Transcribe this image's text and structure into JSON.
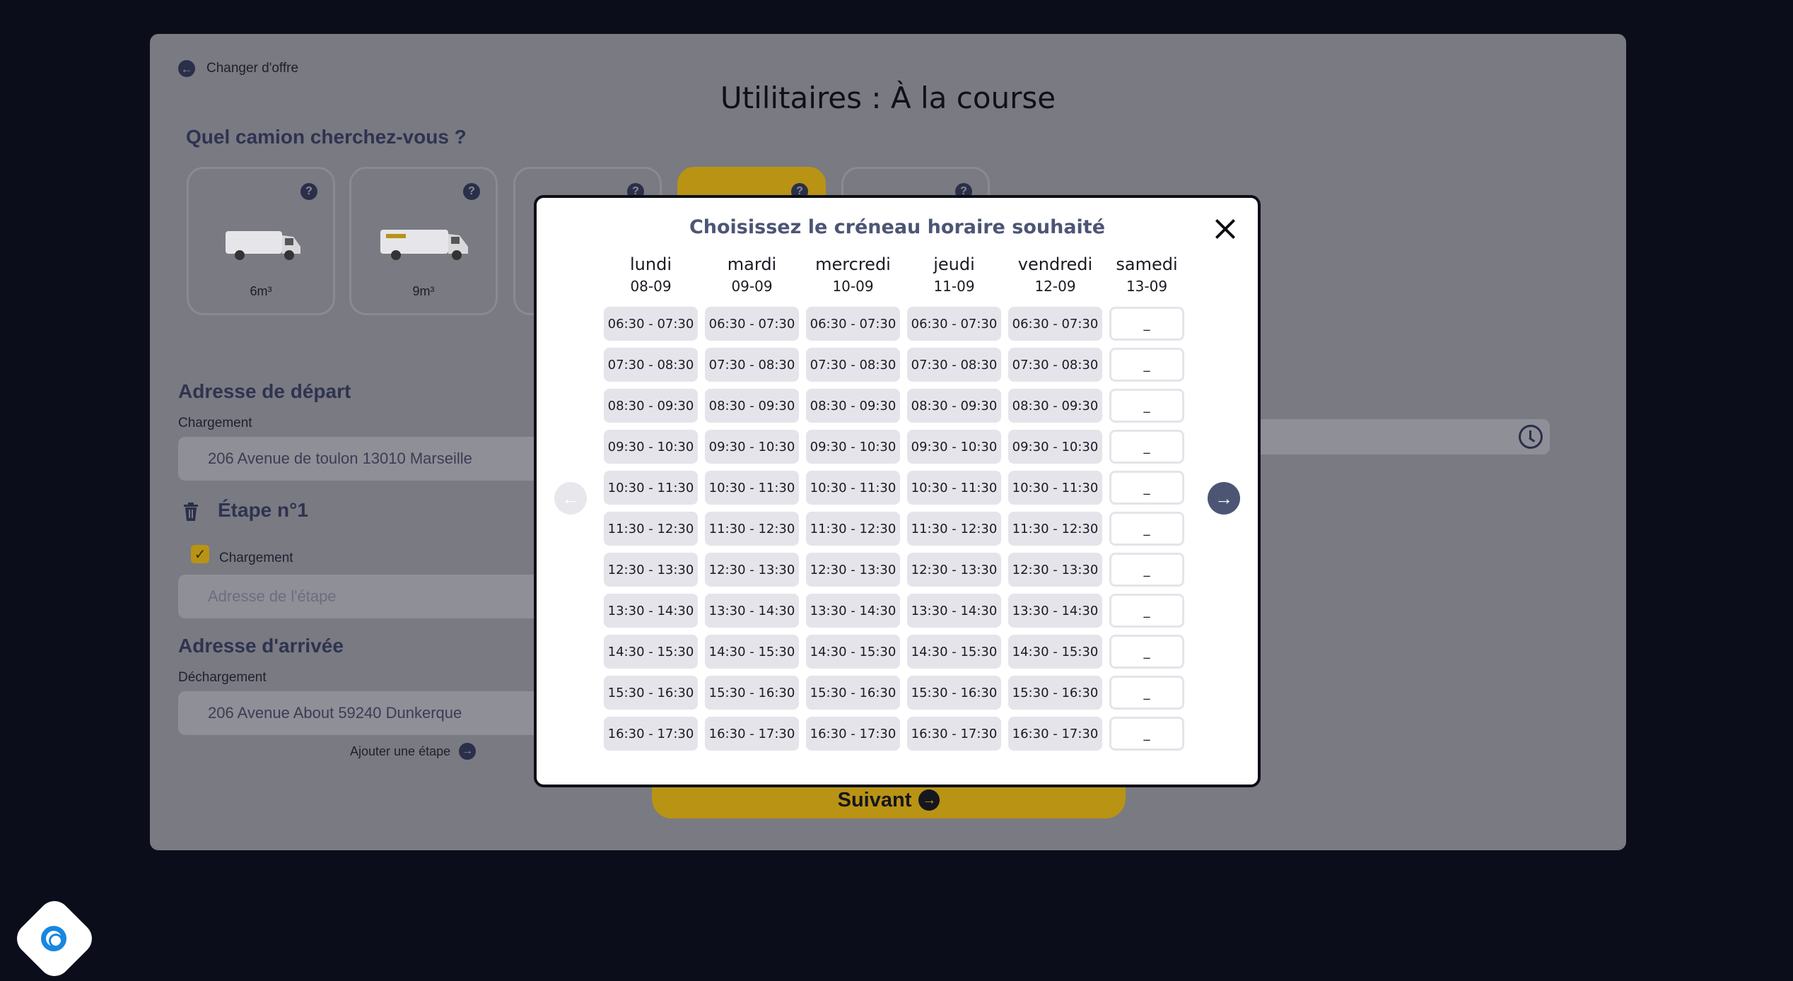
{
  "background": {
    "back_link": "Changer d'offre",
    "title": "Utilitaires : À la course",
    "truck_question": "Quel camion cherchez-vous ?",
    "trucks": [
      {
        "size": "6m³"
      },
      {
        "size": "9m³"
      },
      {
        "size": ""
      },
      {
        "size": ""
      },
      {
        "size": ""
      }
    ],
    "help_glyph": "?",
    "departure": {
      "section_title": "Adresse de départ",
      "label": "Chargement",
      "value": "206 Avenue de toulon 13010 Marseille"
    },
    "step": {
      "section_title": "Étape n°1",
      "checkbox_label": "Chargement",
      "placeholder": "Adresse de l'étape"
    },
    "arrival": {
      "section_title": "Adresse d'arrivée",
      "label": "Déchargement",
      "value": "206 Avenue About 59240 Dunkerque"
    },
    "add_step_label": "Ajouter une étape",
    "next_label": "Suivant"
  },
  "modal": {
    "title": "Choisissez le créneau horaire souhaité",
    "days": [
      {
        "name": "lundi",
        "date": "08-09",
        "slots": [
          "06:30 - 07:30",
          "07:30 - 08:30",
          "08:30 - 09:30",
          "09:30 - 10:30",
          "10:30 - 11:30",
          "11:30 - 12:30",
          "12:30 - 13:30",
          "13:30 - 14:30",
          "14:30 - 15:30",
          "15:30 - 16:30",
          "16:30 - 17:30"
        ]
      },
      {
        "name": "mardi",
        "date": "09-09",
        "slots": [
          "06:30 - 07:30",
          "07:30 - 08:30",
          "08:30 - 09:30",
          "09:30 - 10:30",
          "10:30 - 11:30",
          "11:30 - 12:30",
          "12:30 - 13:30",
          "13:30 - 14:30",
          "14:30 - 15:30",
          "15:30 - 16:30",
          "16:30 - 17:30"
        ]
      },
      {
        "name": "mercredi",
        "date": "10-09",
        "slots": [
          "06:30 - 07:30",
          "07:30 - 08:30",
          "08:30 - 09:30",
          "09:30 - 10:30",
          "10:30 - 11:30",
          "11:30 - 12:30",
          "12:30 - 13:30",
          "13:30 - 14:30",
          "14:30 - 15:30",
          "15:30 - 16:30",
          "16:30 - 17:30"
        ]
      },
      {
        "name": "jeudi",
        "date": "11-09",
        "slots": [
          "06:30 - 07:30",
          "07:30 - 08:30",
          "08:30 - 09:30",
          "09:30 - 10:30",
          "10:30 - 11:30",
          "11:30 - 12:30",
          "12:30 - 13:30",
          "13:30 - 14:30",
          "14:30 - 15:30",
          "15:30 - 16:30",
          "16:30 - 17:30"
        ]
      },
      {
        "name": "vendredi",
        "date": "12-09",
        "slots": [
          "06:30 - 07:30",
          "07:30 - 08:30",
          "08:30 - 09:30",
          "09:30 - 10:30",
          "10:30 - 11:30",
          "11:30 - 12:30",
          "12:30 - 13:30",
          "13:30 - 14:30",
          "14:30 - 15:30",
          "15:30 - 16:30",
          "16:30 - 17:30"
        ]
      },
      {
        "name": "samedi",
        "date": "13-09",
        "slots": [
          "_",
          "_",
          "_",
          "_",
          "_",
          "_",
          "_",
          "_",
          "_",
          "_",
          "_"
        ]
      }
    ],
    "prev_glyph": "←",
    "next_glyph": "→"
  },
  "colors": {
    "accent": "#b99314",
    "modal_title": "#4d5575",
    "slot_bg": "#e4e4ea",
    "support": "#1787e0"
  }
}
